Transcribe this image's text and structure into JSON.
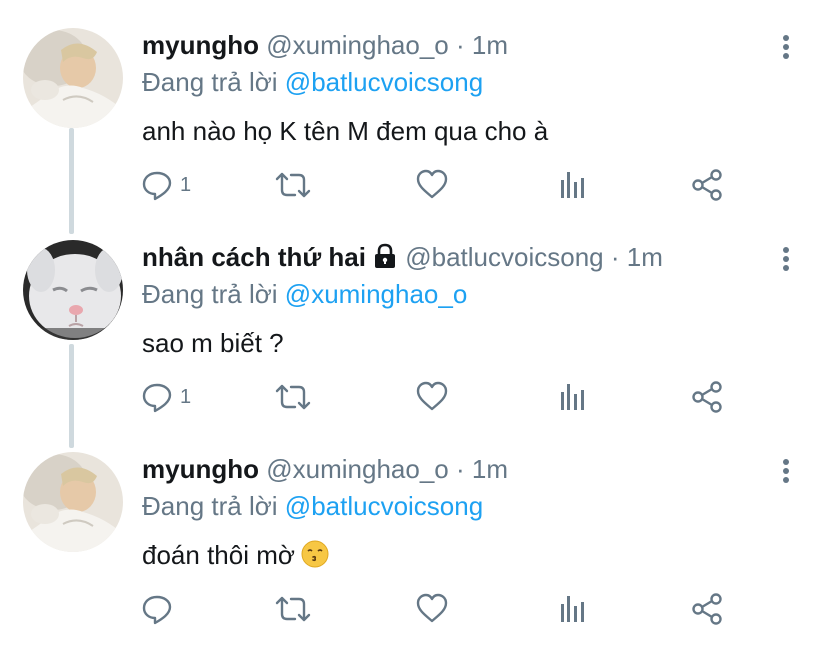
{
  "tweets": [
    {
      "name": "myungho",
      "handle": "@xuminghao_o",
      "dot": "·",
      "time": "1m",
      "replying_prefix": "Đang trả lời",
      "replying_to": "@batlucvoicsong",
      "text": "anh nào họ K tên M đem qua cho à",
      "reply_count": "1",
      "locked": false
    },
    {
      "name": "nhân cách thứ hai",
      "handle": "@batlucvoicsong",
      "dot": "·",
      "time": "1m",
      "replying_prefix": "Đang trả lời",
      "replying_to": "@xuminghao_o",
      "text": "sao m biết ?",
      "reply_count": "1",
      "locked": true
    },
    {
      "name": "myungho",
      "handle": "@xuminghao_o",
      "dot": "·",
      "time": "1m",
      "replying_prefix": "Đang trả lời",
      "replying_to": "@batlucvoicsong",
      "text": "đoán thôi mờ",
      "emoji": "kissing-face",
      "reply_count": "",
      "locked": false
    }
  ],
  "icons": [
    "reply-icon",
    "retweet-icon",
    "like-icon",
    "analytics-icon",
    "share-icon",
    "more-icon",
    "lock-icon"
  ],
  "colors": {
    "name": "#14171a",
    "meta": "#657786",
    "mention": "#1da1f2",
    "thread_line": "#cfd9de"
  }
}
